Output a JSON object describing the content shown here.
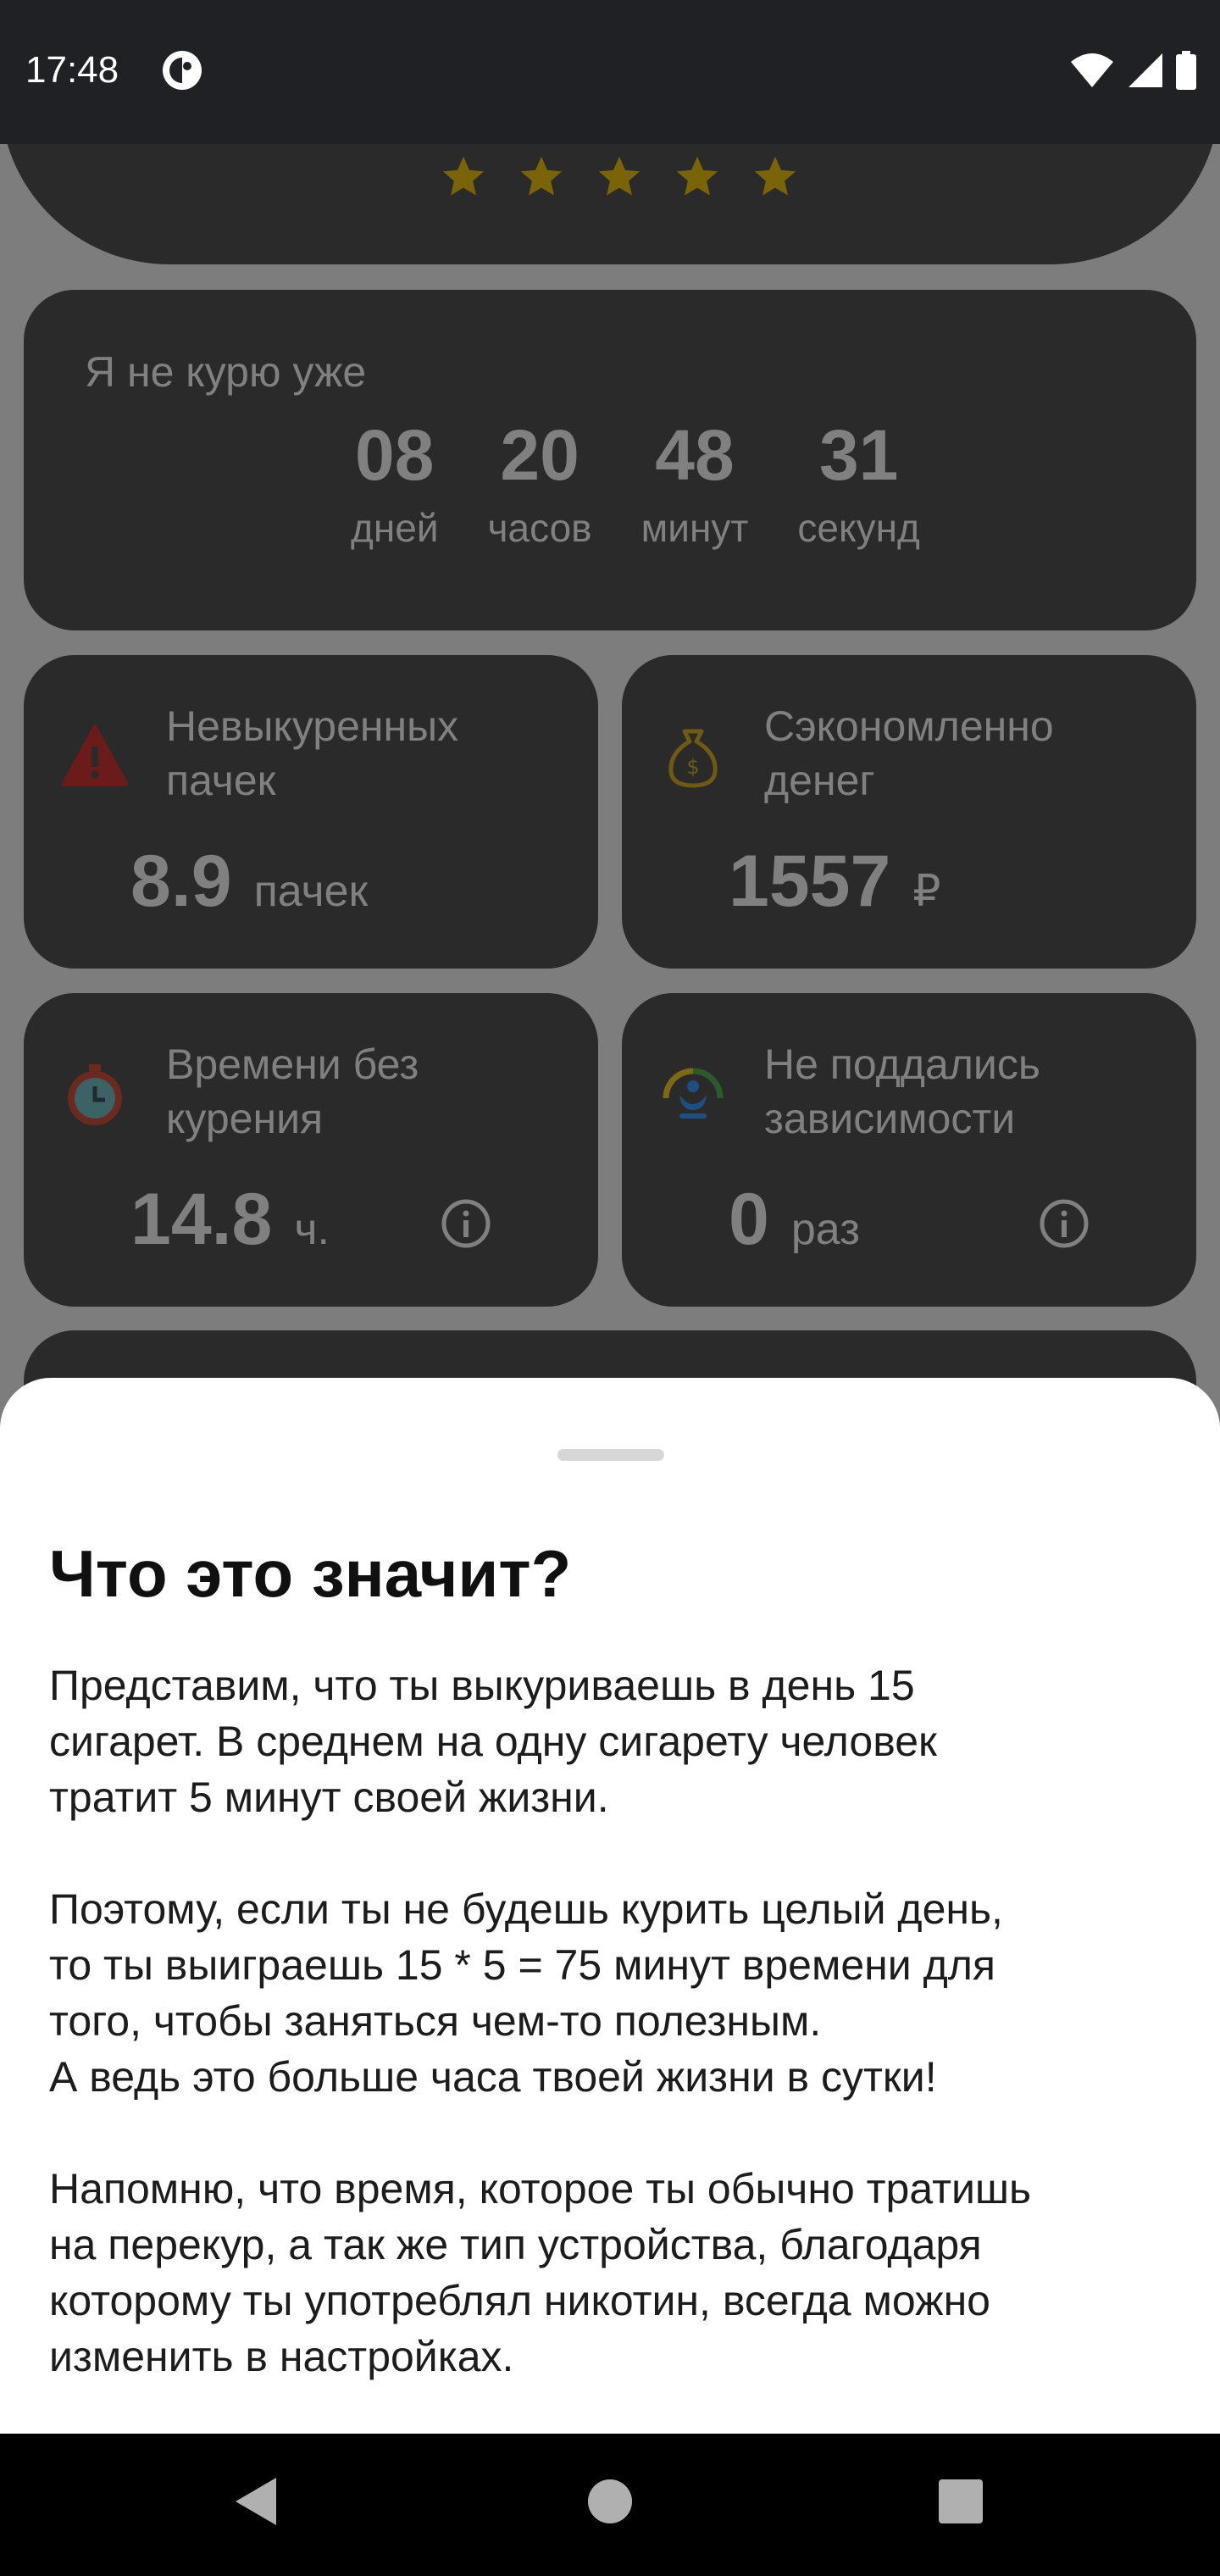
{
  "status_bar": {
    "time": "17:48"
  },
  "rating": {
    "stars": 5
  },
  "counter": {
    "label": "Я не курю уже",
    "units": [
      {
        "value": "08",
        "caption": "дней"
      },
      {
        "value": "20",
        "caption": "часов"
      },
      {
        "value": "48",
        "caption": "минут"
      },
      {
        "value": "31",
        "caption": "секунд"
      }
    ]
  },
  "stats": [
    {
      "title": "Невыкуренных пачек",
      "value": "8.9",
      "unit": "пачек",
      "icon": "warning-icon",
      "color": "#d0312d"
    },
    {
      "title": "Сэкономленно денег",
      "value": "1557",
      "unit": "₽",
      "icon": "money-bag-icon",
      "color": "#c9a227"
    },
    {
      "title": "Времени без курения",
      "value": "14.8",
      "unit": "ч.",
      "icon": "stopwatch-icon",
      "color": "#d0312d"
    },
    {
      "title": "Не поддались зависимости",
      "value": "0",
      "unit": "раз",
      "icon": "protected-person-icon",
      "color": "#2a7fd4"
    }
  ],
  "sheet": {
    "title": "Что это значит?",
    "body": "Представим, что ты выкуриваешь в день 15\nсигарет. В среднем на одну сигарету человек\nтратит 5 минут своей жизни.\n\nПоэтому, если ты не будешь курить целый день,\nто ты выиграешь 15 * 5 = 75 минут времени для\nтого, чтобы заняться чем-то полезным.\nА ведь это больше часа твоей жизни в сутки!\n\nНапомню, что время, которое ты обычно тратишь\nна перекур, а так же тип устройства, благодаря\nкоторому ты употреблял никотин, всегда можно\nизменить в настройках."
  }
}
